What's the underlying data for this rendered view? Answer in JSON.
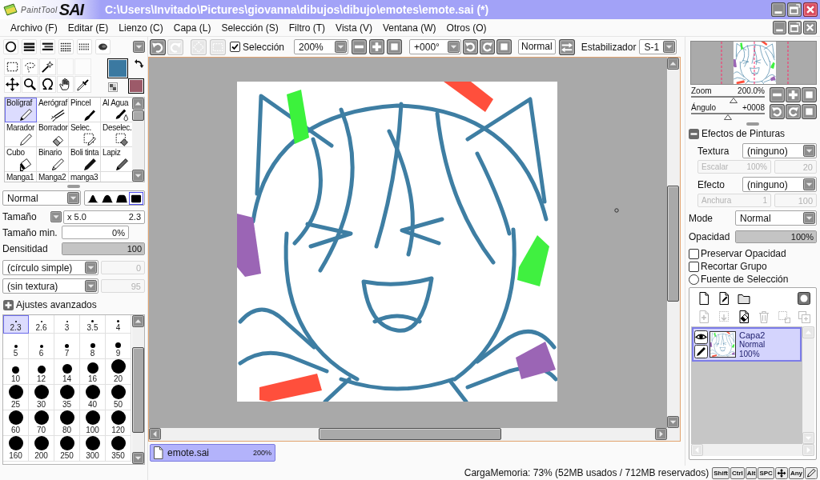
{
  "window": {
    "logo_small": "PaintTool",
    "logo_big": "SAI",
    "title": "C:\\Users\\Invitado\\Pictures\\giovanna\\dibujos\\dibujo\\emotes\\emote.sai (*)"
  },
  "menu": [
    "Archivo (F)",
    "Editar (E)",
    "Lienzo (C)",
    "Capa (L)",
    "Selección (S)",
    "Filtro (T)",
    "Vista (V)",
    "Ventana (W)",
    "Otros (O)"
  ],
  "colors": [
    {
      "color": "#3b79a1"
    },
    {
      "color": "#9c5a69"
    }
  ],
  "tools": [
    {
      "label": "Bolígraf",
      "selected": true
    },
    {
      "label": "Aerógraf",
      "selected": false
    },
    {
      "label": "Pincel",
      "selected": false
    },
    {
      "label": "Al Agua",
      "selected": false
    },
    {
      "label": "Marador",
      "selected": false
    },
    {
      "label": "Borrador",
      "selected": false
    },
    {
      "label": "Selec.",
      "selected": false
    },
    {
      "label": "Deselec.",
      "selected": false
    },
    {
      "label": "Cubo",
      "selected": false
    },
    {
      "label": "Binario",
      "selected": false
    },
    {
      "label": "Boli tinta",
      "selected": false
    },
    {
      "label": "Lapiz",
      "selected": false
    },
    {
      "label": "Manga1",
      "selected": false
    },
    {
      "label": "Manga2",
      "selected": false
    },
    {
      "label": "manga3",
      "selected": false
    }
  ],
  "brush": {
    "blend": "Normal",
    "edges": [
      {
        "selected": false
      },
      {
        "selected": false
      },
      {
        "selected": false
      },
      {
        "selected": true
      }
    ],
    "size": {
      "label": "Tamaño",
      "multiplier": "x 5.0",
      "value": "2.3"
    },
    "min_size": {
      "label": "Tamaño min.",
      "value": "0%"
    },
    "density": {
      "label": "Densitidad",
      "value": "100",
      "level": 1
    },
    "shape": {
      "value": "(círculo simple)",
      "amount": {
        "value": "0",
        "disabled": true
      }
    },
    "texture": {
      "value": "(sin textura)",
      "amount": {
        "value": "95",
        "disabled": true
      }
    }
  },
  "advanced": {
    "label": "Ajustes avanzados",
    "expanded": false
  },
  "brush_sizes": [
    {
      "label": "2.3",
      "selected": true
    },
    {
      "label": "2.6",
      "selected": false
    },
    {
      "label": "3",
      "selected": false
    },
    {
      "label": "3.5",
      "selected": false
    },
    {
      "label": "4",
      "selected": false
    },
    {
      "label": "5",
      "selected": false
    },
    {
      "label": "6",
      "selected": false
    },
    {
      "label": "7",
      "selected": false
    },
    {
      "label": "8",
      "selected": false
    },
    {
      "label": "9",
      "selected": false
    },
    {
      "label": "10",
      "selected": false
    },
    {
      "label": "12",
      "selected": false
    },
    {
      "label": "14",
      "selected": false
    },
    {
      "label": "16",
      "selected": false
    },
    {
      "label": "20",
      "selected": false
    },
    {
      "label": "25",
      "selected": false
    },
    {
      "label": "30",
      "selected": false
    },
    {
      "label": "35",
      "selected": false
    },
    {
      "label": "40",
      "selected": false
    },
    {
      "label": "50",
      "selected": false
    },
    {
      "label": "60",
      "selected": false
    },
    {
      "label": "70",
      "selected": false
    },
    {
      "label": "80",
      "selected": false
    },
    {
      "label": "100",
      "selected": false
    },
    {
      "label": "120",
      "selected": false
    },
    {
      "label": "160",
      "selected": false
    },
    {
      "label": "200",
      "selected": false
    },
    {
      "label": "250",
      "selected": false
    },
    {
      "label": "300",
      "selected": false
    },
    {
      "label": "350",
      "selected": false
    }
  ],
  "toolbar": {
    "history": [
      {
        "disabled": false
      },
      {
        "disabled": true
      }
    ],
    "selection_tools": [
      {
        "disabled": true
      },
      {
        "disabled": true
      }
    ],
    "selection": {
      "label": "Selección",
      "checked": true
    },
    "zoom": "200%",
    "angle": "+000°",
    "blend": "Normal",
    "stabilizer_label": "Estabilizador",
    "stabilizer": "S-1"
  },
  "documents": [
    {
      "name": "emote.sai",
      "zoom": "200%",
      "selected": true
    }
  ],
  "status": {
    "memory": "CargaMemoria: 73% (52MB usados / 712MB reservados)",
    "keys": [
      {
        "kind": "text",
        "label": "Shift"
      },
      {
        "kind": "text",
        "label": "Ctrl"
      },
      {
        "kind": "text",
        "label": "Alt"
      },
      {
        "kind": "text",
        "label": "SPC"
      },
      {
        "kind": "move"
      },
      {
        "kind": "text",
        "label": "Any"
      },
      {
        "kind": "pen"
      }
    ]
  },
  "navigator": {
    "zoom": {
      "label": "Zoom",
      "value": "200.0%",
      "level": 0.58
    },
    "angle": {
      "label": "Ángulo",
      "value": "+0008",
      "level": 0.5
    }
  },
  "paint_effects": {
    "title": "Efectos de Pinturas",
    "expanded": true,
    "texture": {
      "label": "Textura",
      "value": "(ninguno)"
    },
    "scale": {
      "label": "Escalar",
      "value": "100%",
      "disabled": true
    },
    "scale_amount": {
      "value": "20",
      "disabled": true
    },
    "effect": {
      "label": "Efecto",
      "value": "(ninguno)"
    },
    "width": {
      "label": "Anchura",
      "value": "1",
      "disabled": true
    },
    "width_amount": {
      "value": "100",
      "disabled": true
    }
  },
  "layer_properties": {
    "mode": {
      "label": "Mode",
      "value": "Normal"
    },
    "opacity": {
      "label": "Opacidad",
      "value": "100%",
      "level": 1
    },
    "options": [
      {
        "kind": "checkbox",
        "label": "Preservar Opacidad",
        "checked": false
      },
      {
        "kind": "checkbox",
        "label": "Recortar Grupo",
        "checked": false
      },
      {
        "kind": "radio",
        "label": "Fuente de Selección",
        "checked": false
      }
    ]
  },
  "layer_tools": {
    "top": [
      {
        "disabled": false
      },
      {
        "disabled": false
      },
      {
        "disabled": false
      },
      {
        "disabled": false
      }
    ],
    "bottom": [
      {
        "disabled": true
      },
      {
        "disabled": true
      },
      {
        "disabled": false
      },
      {
        "disabled": true
      },
      {
        "disabled": true
      },
      {
        "disabled": true
      }
    ]
  },
  "layers": [
    {
      "name": "Capa2",
      "mode": "Normal",
      "opacity": "100%",
      "selected": true,
      "visible": true
    }
  ]
}
